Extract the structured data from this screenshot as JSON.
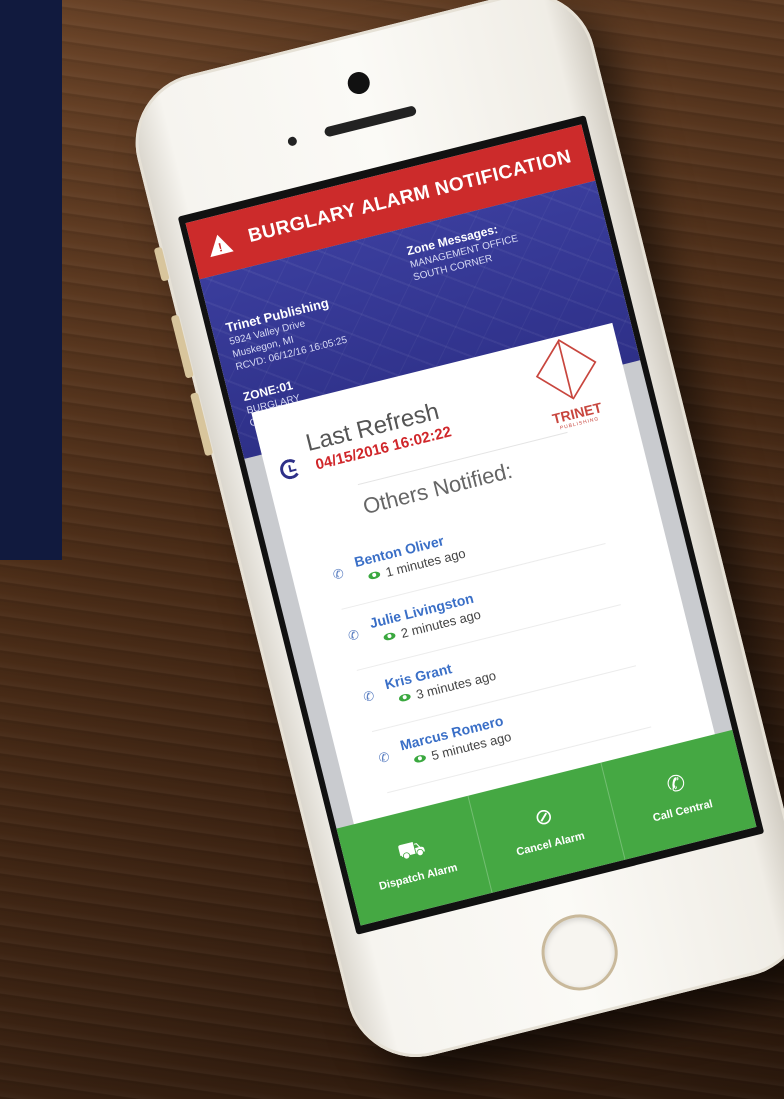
{
  "alert": {
    "icon": "warning-triangle-icon",
    "title": "BURGLARY ALARM NOTIFICATION"
  },
  "account": {
    "name": "Trinet Publishing",
    "address_line1": "5924 Valley Drive",
    "address_line2": "Muskegon, MI",
    "received": "RCVD: 06/12/16 16:05:25"
  },
  "zone": {
    "title": "ZONE:01",
    "type": "BURGLARY",
    "location": "OFFICE AREA PIR"
  },
  "zone_messages": {
    "title": "Zone Messages:",
    "line1": "MANAGEMENT OFFICE",
    "line2": "SOUTH CORNER"
  },
  "refresh": {
    "label": "Last Refresh",
    "timestamp": "04/15/2016 16:02:22"
  },
  "logo": {
    "word": "TRINET",
    "sub": "PUBLISHING"
  },
  "others_notified": {
    "heading": "Others Notified:",
    "people": [
      {
        "name": "Benton Oliver",
        "seen": "1 minutes ago"
      },
      {
        "name": "Julie Livingston",
        "seen": "2 minutes ago"
      },
      {
        "name": "Kris Grant",
        "seen": "3 minutes ago"
      },
      {
        "name": "Marcus Romero",
        "seen": "5 minutes ago"
      }
    ]
  },
  "actions": {
    "dispatch": {
      "label": "Dispatch Alarm",
      "icon": "truck-icon"
    },
    "cancel": {
      "label": "Cancel Alarm",
      "icon": "cancel-icon"
    },
    "call": {
      "label": "Call Central",
      "icon": "phone-icon"
    }
  },
  "colors": {
    "alert_red": "#cc2b2b",
    "header_blue": "#2e3088",
    "action_green": "#45a843",
    "timestamp_red": "#d0262a",
    "name_blue": "#3a6fc7"
  }
}
